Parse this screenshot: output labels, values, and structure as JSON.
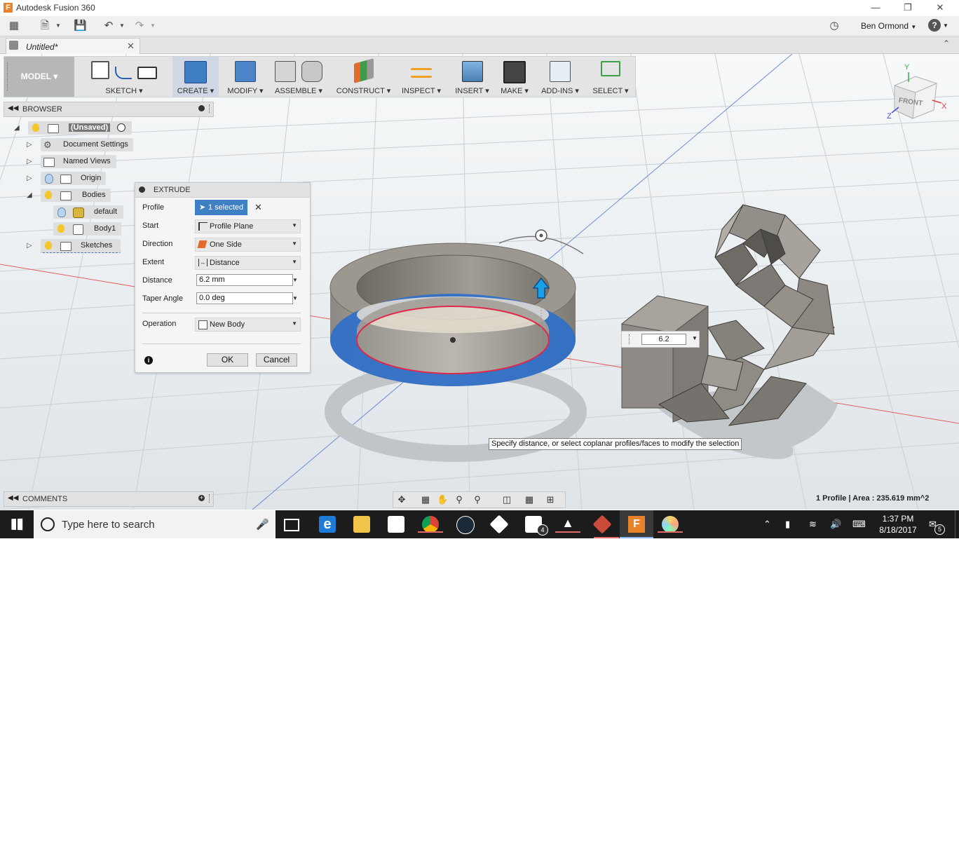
{
  "window": {
    "title": "Autodesk Fusion 360",
    "app_logo": "F"
  },
  "qab": {
    "user": "Ben Ormond",
    "user_arrow": "▼",
    "help": "?",
    "help_arrow": "▼"
  },
  "doc_tab": {
    "name": "Untitled*"
  },
  "toolbar": {
    "workspace": "MODEL ▾",
    "groups": [
      {
        "label": "SKETCH ▾"
      },
      {
        "label": "CREATE ▾"
      },
      {
        "label": "MODIFY ▾"
      },
      {
        "label": "ASSEMBLE ▾"
      },
      {
        "label": "CONSTRUCT ▾"
      },
      {
        "label": "INSPECT ▾"
      },
      {
        "label": "INSERT ▾"
      },
      {
        "label": "MAKE ▾"
      },
      {
        "label": "ADD-INS ▾"
      },
      {
        "label": "SELECT ▾"
      }
    ]
  },
  "browser": {
    "title": "BROWSER",
    "nodes": [
      {
        "label": "(Unsaved)"
      },
      {
        "label": "Document Settings"
      },
      {
        "label": "Named Views"
      },
      {
        "label": "Origin"
      },
      {
        "label": "Bodies"
      },
      {
        "label": "default"
      },
      {
        "label": "Body1"
      },
      {
        "label": "Sketches"
      }
    ]
  },
  "extrude": {
    "title": "EXTRUDE",
    "profile_label": "Profile",
    "profile_value": "1 selected",
    "start_label": "Start",
    "start_value": "Profile Plane",
    "direction_label": "Direction",
    "direction_value": "One Side",
    "extent_label": "Extent",
    "extent_value": "Distance",
    "distance_label": "Distance",
    "distance_value": "6.2 mm",
    "taper_label": "Taper Angle",
    "taper_value": "0.0 deg",
    "operation_label": "Operation",
    "operation_value": "New Body",
    "ok": "OK",
    "cancel": "Cancel"
  },
  "viewport": {
    "distance_input": "6.2",
    "tooltip": "Specify distance, or select coplanar profiles/faces to modify the selection",
    "viewcube_face": "FRONT",
    "axis_y": "Y",
    "axis_x": "X",
    "axis_z": "Z"
  },
  "comments": {
    "title": "COMMENTS"
  },
  "status": "1 Profile | Area : 235.619 mm^2",
  "taskbar": {
    "search_placeholder": "Type here to search",
    "time": "1:37 PM",
    "date": "8/18/2017",
    "mail_badge": "4",
    "notif_badge": "5"
  },
  "colors": {
    "accent": "#3f7fc4",
    "selection_blue": "#2f6fc9",
    "profile_red": "#e0284a"
  }
}
